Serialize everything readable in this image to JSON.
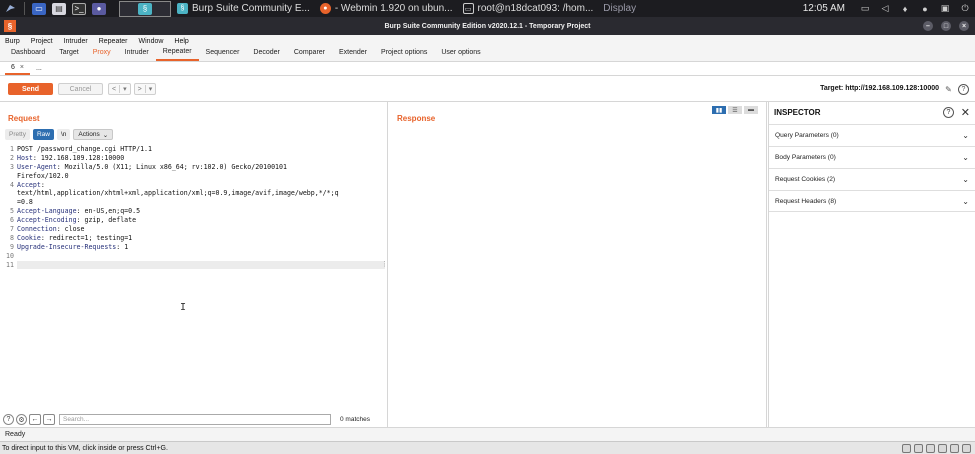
{
  "taskbar": {
    "tasks": [
      {
        "label": "Burp Suite Community E..."
      },
      {
        "label": "- Webmin 1.920 on ubun..."
      },
      {
        "label": "root@n18dcat093: /hom..."
      },
      {
        "label": "Display"
      }
    ],
    "clock": "12:05 AM"
  },
  "window": {
    "title": "Burp Suite Community Edition v2020.12.1 - Temporary Project"
  },
  "menu": [
    "Burp",
    "Project",
    "Intruder",
    "Repeater",
    "Window",
    "Help"
  ],
  "main_tabs": [
    {
      "label": "Dashboard"
    },
    {
      "label": "Target"
    },
    {
      "label": "Proxy",
      "state": "orange"
    },
    {
      "label": "Intruder"
    },
    {
      "label": "Repeater",
      "state": "active"
    },
    {
      "label": "Sequencer"
    },
    {
      "label": "Decoder"
    },
    {
      "label": "Comparer"
    },
    {
      "label": "Extender"
    },
    {
      "label": "Project options"
    },
    {
      "label": "User options"
    }
  ],
  "sub_tabs": {
    "active_label": "6",
    "close_glyph": "×",
    "more_label": "..."
  },
  "toolbar": {
    "send_label": "Send",
    "cancel_label": "Cancel",
    "prev_glyph": "<",
    "next_glyph": ">",
    "dropdown_glyph": "▾",
    "target_text": "Target: http://192.168.109.128:10000"
  },
  "request": {
    "title": "Request",
    "view_buttons": {
      "pretty": "Pretty",
      "raw": "Raw",
      "newline": "\\n",
      "actions": "Actions"
    },
    "lines": [
      {
        "num": "1",
        "key": "",
        "text": "POST /password_change.cgi HTTP/1.1"
      },
      {
        "num": "2",
        "key": "Host",
        "text": ": 192.168.109.128:10000"
      },
      {
        "num": "3",
        "key": "User-Agent",
        "text": ": Mozilla/5.0 (X11; Linux x86_64; rv:102.0) Gecko/20100101"
      },
      {
        "num": "",
        "key": "",
        "text": "Firefox/102.0"
      },
      {
        "num": "4",
        "key": "Accept",
        "text": ":"
      },
      {
        "num": "",
        "key": "",
        "text": "text/html,application/xhtml+xml,application/xml;q=0.9,image/avif,image/webp,*/*;q"
      },
      {
        "num": "",
        "key": "",
        "text": "=0.8"
      },
      {
        "num": "5",
        "key": "Accept-Language",
        "text": ": en-US,en;q=0.5"
      },
      {
        "num": "6",
        "key": "Accept-Encoding",
        "text": ": gzip, deflate"
      },
      {
        "num": "7",
        "key": "Connection",
        "text": ": close"
      },
      {
        "num": "8",
        "key": "Cookie",
        "text": ": redirect=1; testing=1"
      },
      {
        "num": "9",
        "key": "Upgrade-Insecure-Requests",
        "text": ": 1"
      },
      {
        "num": "10",
        "key": "",
        "text": ""
      },
      {
        "num": "11",
        "key": "",
        "text": ""
      }
    ],
    "search_placeholder": "Search...",
    "matches": "0 matches"
  },
  "response": {
    "title": "Response"
  },
  "inspector": {
    "title": "INSPECTOR",
    "sections": [
      {
        "label": "Query Parameters (0)"
      },
      {
        "label": "Body Parameters (0)"
      },
      {
        "label": "Request Cookies (2)"
      },
      {
        "label": "Request Headers (8)"
      }
    ]
  },
  "status": {
    "text": "Ready"
  },
  "vm_bar": {
    "text": "To direct input to this VM, click inside or press Ctrl+G."
  },
  "colors": {
    "accent": "#e8632b",
    "raw_active": "#2d6eb0",
    "header_key": "#27317a"
  }
}
